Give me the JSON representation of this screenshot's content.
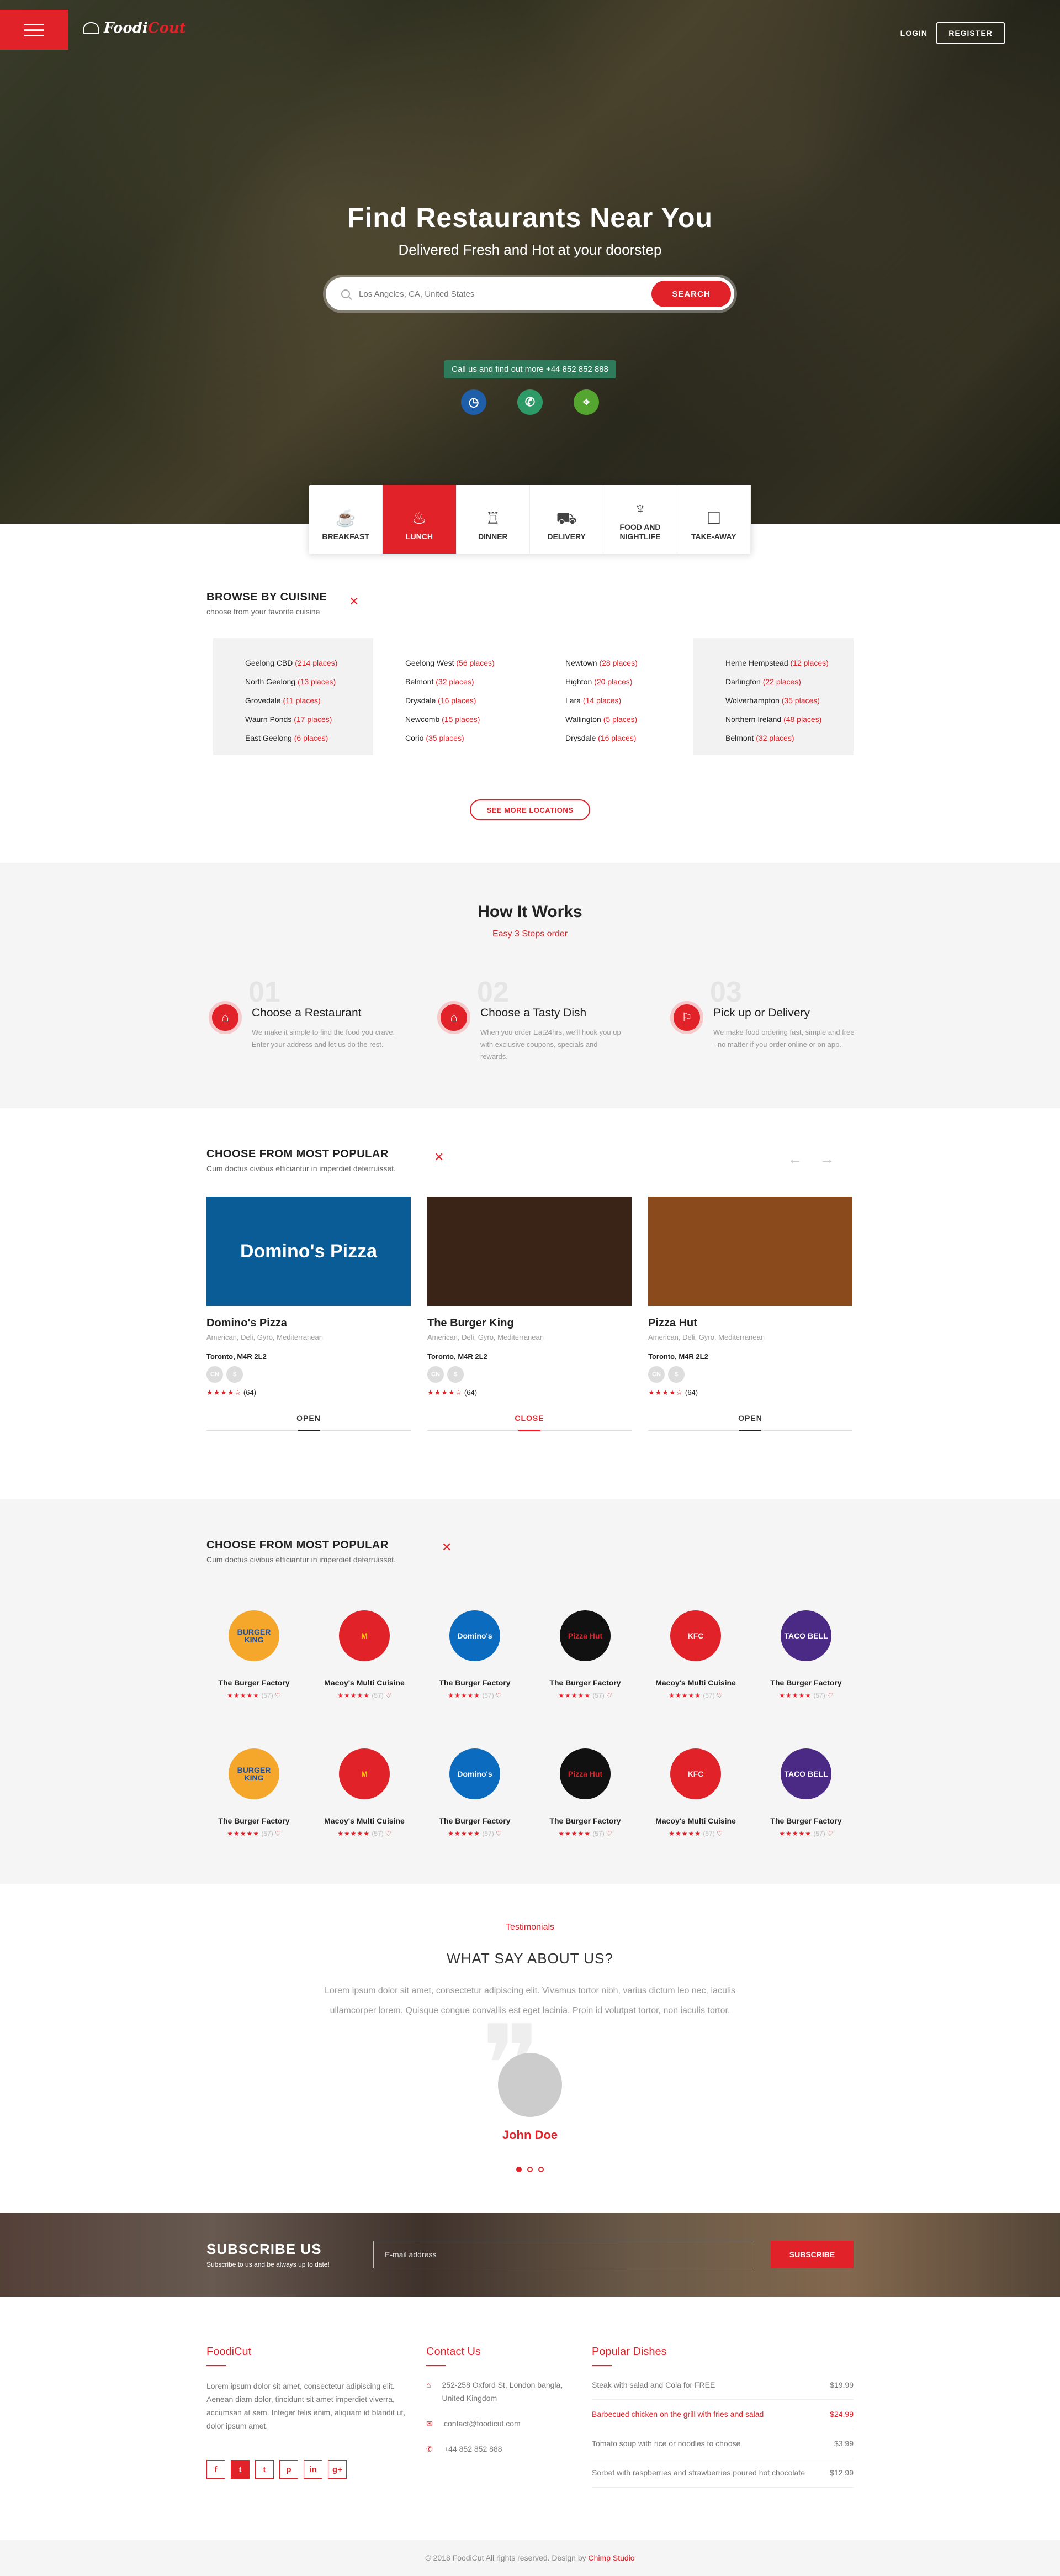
{
  "header": {
    "logo_main": "Foodi",
    "logo_accent": "Cout",
    "login": "LOGIN",
    "register": "REGISTER"
  },
  "hero": {
    "title": "Find Restaurants Near You",
    "subtitle": "Delivered Fresh and Hot at your doorstep",
    "search_placeholder": "Los Angeles, CA, United States",
    "search_button": "SEARCH",
    "call_text": "Call us and find out more +44 852 852 888"
  },
  "meals": [
    {
      "label": "BREAKFAST",
      "icon": "breakfast-icon"
    },
    {
      "label": "LUNCH",
      "icon": "lunch-icon"
    },
    {
      "label": "DINNER",
      "icon": "dinner-icon"
    },
    {
      "label": "DELIVERY",
      "icon": "delivery-icon"
    },
    {
      "label": "FOOD AND NIGHTLIFE",
      "icon": "nightlife-icon"
    },
    {
      "label": "TAKE-AWAY",
      "icon": "takeaway-icon"
    }
  ],
  "browse": {
    "title": "BROWSE BY CUISINE",
    "subtitle": "choose from your favorite cuisine",
    "button": "SEE MORE LOCATIONS",
    "columns": [
      [
        [
          "Geelong CBD",
          "(214 places)"
        ],
        [
          "North Geelong",
          "(13 places)"
        ],
        [
          "Grovedale",
          "(11 places)"
        ],
        [
          "Waurn Ponds",
          "(17 places)"
        ],
        [
          "East Geelong",
          "(6 places)"
        ]
      ],
      [
        [
          "Geelong West",
          "(56 places)"
        ],
        [
          "Belmont",
          "(32 places)"
        ],
        [
          "Drysdale",
          "(16 places)"
        ],
        [
          "Newcomb",
          "(15 places)"
        ],
        [
          "Corio",
          "(35 places)"
        ]
      ],
      [
        [
          "Newtown",
          "(28 places)"
        ],
        [
          "Highton",
          "(20 places)"
        ],
        [
          "Lara",
          "(14 places)"
        ],
        [
          "Wallington",
          "(5 places)"
        ],
        [
          "Drysdale",
          "(16 places)"
        ]
      ],
      [
        [
          "Herne Hempstead",
          "(12 places)"
        ],
        [
          "Darlington",
          "(22 places)"
        ],
        [
          "Wolverhampton",
          "(35 places)"
        ],
        [
          "Northern Ireland",
          "(48 places)"
        ],
        [
          "Belmont",
          "(32 places)"
        ]
      ]
    ]
  },
  "how": {
    "title": "How It Works",
    "subtitle": "Easy 3 Steps order",
    "steps": [
      {
        "num": "01",
        "title": "Choose a Restaurant",
        "text": "We make it simple to find the food you crave. Enter your address and let us do the rest."
      },
      {
        "num": "02",
        "title": "Choose a Tasty Dish",
        "text": "When you order Eat24hrs, we'll hook you up with exclusive coupons, specials and rewards."
      },
      {
        "num": "03",
        "title": "Pick up or Delivery",
        "text": "We make food ordering fast, simple and free - no matter if you order online or on app."
      }
    ]
  },
  "popular": {
    "title": "CHOOSE FROM MOST POPULAR",
    "subtitle": "Cum doctus civibus efficiantur in imperdiet deterruisset.",
    "cards": [
      {
        "name": "Domino's Pizza",
        "img_text": "Domino's Pizza",
        "color": "#0a5c97",
        "cuisine": "American, Deli, Gyro, Mediterranean",
        "loc": "Toronto, M4R 2L2",
        "stars": "★★★★☆",
        "reviews": "(64)",
        "status": "OPEN"
      },
      {
        "name": "The Burger King",
        "img_text": "",
        "color": "#3a2418",
        "cuisine": "American, Deli, Gyro, Mediterranean",
        "loc": "Toronto, M4R 2L2",
        "stars": "★★★★☆",
        "reviews": "(64)",
        "status": "CLOSE"
      },
      {
        "name": "Pizza Hut",
        "img_text": "",
        "color": "#8a4a1c",
        "cuisine": "American, Deli, Gyro, Mediterranean",
        "loc": "Toronto, M4R 2L2",
        "stars": "★★★★☆",
        "reviews": "(64)",
        "status": "OPEN"
      }
    ]
  },
  "brands": {
    "title": "CHOOSE FROM MOST POPULAR",
    "subtitle": "Cum doctus civibus efficiantur in imperdiet deterruisset.",
    "items": [
      {
        "name": "The Burger Factory",
        "logo": "BURGER KING",
        "bg": "#f4a72a",
        "fg": "#1d4fa0"
      },
      {
        "name": "Macoy's Multi Cuisine",
        "logo": "M",
        "bg": "#e12229",
        "fg": "#ffcb05"
      },
      {
        "name": "The Burger Factory",
        "logo": "Domino's",
        "bg": "#0a6bbf",
        "fg": "#ffffff"
      },
      {
        "name": "The Burger Factory",
        "logo": "Pizza Hut",
        "bg": "#111111",
        "fg": "#e12229"
      },
      {
        "name": "Macoy's Multi Cuisine",
        "logo": "KFC",
        "bg": "#e12229",
        "fg": "#ffffff"
      },
      {
        "name": "The Burger Factory",
        "logo": "TACO BELL",
        "bg": "#4b2a85",
        "fg": "#ffffff"
      }
    ],
    "stars": "★★★★★",
    "count": "(57)"
  },
  "testimonials": {
    "label": "Testimonials",
    "title": "WHAT SAY ABOUT US?",
    "text": "Lorem ipsum dolor sit amet, consectetur adipiscing elit. Vivamus tortor nibh, varius dictum leo nec, iaculis ullamcorper lorem. Quisque congue convallis est eget lacinia. Proin id volutpat tortor, non iaculis tortor.",
    "name": "John Doe"
  },
  "subscribe": {
    "title": "SUBSCRIBE US",
    "text": "Subscribe to us and be always up to date!",
    "placeholder": "E-mail address",
    "button": "SUBSCRIBE"
  },
  "footer": {
    "about_title": "FoodiCut",
    "about_text": "Lorem ipsum dolor sit amet, consectetur adipiscing elit. Aenean diam dolor, tincidunt sit amet imperdiet viverra, accumsan at sem. Integer felis enim, aliquam id blandit ut, dolor ipsum amet.",
    "contact_title": "Contact Us",
    "address": "252-258 Oxford St, London bangla, United Kingdom",
    "email": "contact@foodicut.com",
    "phone": "+44 852 852 888",
    "dishes_title": "Popular Dishes",
    "dishes": [
      [
        "Steak with salad and Cola for FREE",
        "$19.99"
      ],
      [
        "Barbecued chicken on the grill with fries and salad",
        "$24.99"
      ],
      [
        "Tomato soup with rice or noodles to choose",
        "$3.99"
      ],
      [
        "Sorbet with raspberries and strawberries poured hot chocolate",
        "$12.99"
      ]
    ],
    "copyright": "© 2018 FoodiCut All rights reserved. Design by",
    "designer": "Chimp Studio"
  }
}
